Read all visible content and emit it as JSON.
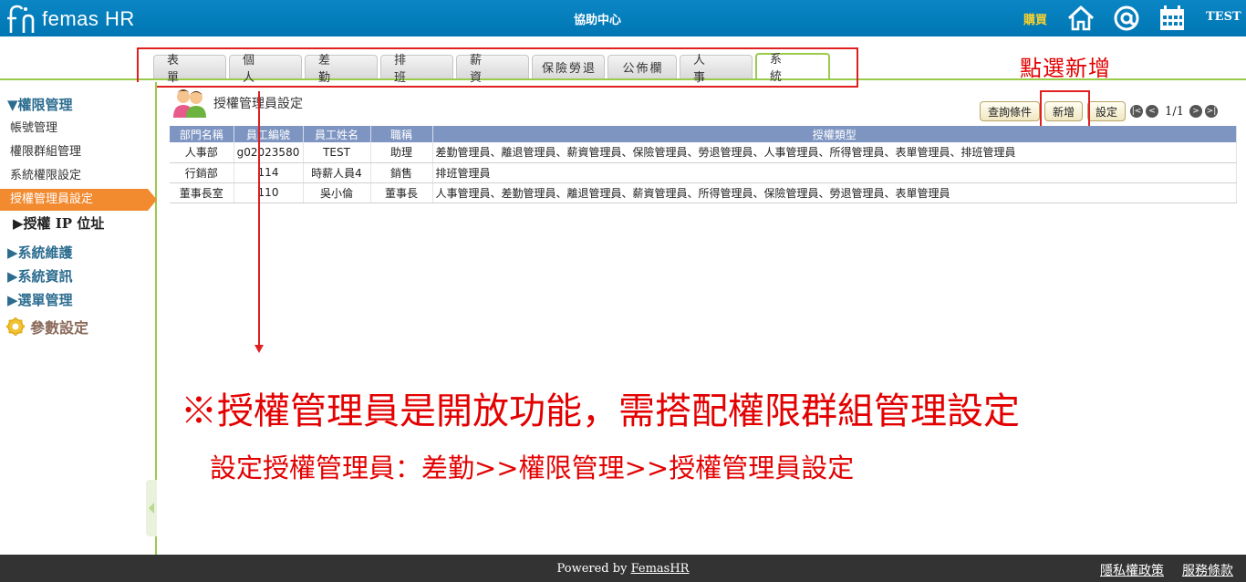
{
  "header": {
    "logo_text": "femas HR",
    "center_title": "協助中心",
    "buy_label": "購買",
    "user_name": "TEST"
  },
  "tabs": [
    {
      "label": "表 單"
    },
    {
      "label": "個 人"
    },
    {
      "label": "差 勤"
    },
    {
      "label": "排 班"
    },
    {
      "label": "薪 資"
    },
    {
      "label": "保險勞退"
    },
    {
      "label": "公佈欄"
    },
    {
      "label": "人 事"
    },
    {
      "label": "系 統"
    }
  ],
  "annotations": {
    "click_add": "點選新增",
    "note_line1": "※授權管理員是開放功能，需搭配權限群組管理設定",
    "note_line2": "設定授權管理員：差勤>>權限管理>>授權管理員設定"
  },
  "sidebar": {
    "section_permissions": "▼權限管理",
    "items": [
      {
        "label": "帳號管理"
      },
      {
        "label": "權限群組管理"
      },
      {
        "label": "系統權限設定"
      },
      {
        "label": "授權管理員設定"
      }
    ],
    "ip_auth": "▶授權 IP 位址",
    "section_maintenance": "▶系統維護",
    "section_info": "▶系統資訊",
    "section_menu": "▶選單管理",
    "params": "參數設定"
  },
  "main": {
    "page_title": "授權管理員設定",
    "toolbar": {
      "query_label": "查詢條件",
      "add_label": "新增",
      "settings_label": "設定",
      "page_indicator": "1/1"
    },
    "columns": [
      "部門名稱",
      "員工編號",
      "員工姓名",
      "職稱",
      "授權類型"
    ],
    "rows": [
      {
        "dept": "人事部",
        "emp_no": "g02023580",
        "name": "TEST",
        "title": "助理",
        "types": "差勤管理員、離退管理員、薪資管理員、保險管理員、勞退管理員、人事管理員、所得管理員、表單管理員、排班管理員"
      },
      {
        "dept": "行銷部",
        "emp_no": "114",
        "name": "時薪人員4",
        "title": "銷售",
        "types": "排班管理員"
      },
      {
        "dept": "董事長室",
        "emp_no": "110",
        "name": "吳小倫",
        "title": "董事長",
        "types": "人事管理員、差勤管理員、離退管理員、薪資管理員、所得管理員、保險管理員、勞退管理員、表單管理員"
      }
    ]
  },
  "footer": {
    "powered_prefix": "Powered by ",
    "powered_link": "FemasHR",
    "privacy": "隱私權政策",
    "terms": "服務條款"
  }
}
